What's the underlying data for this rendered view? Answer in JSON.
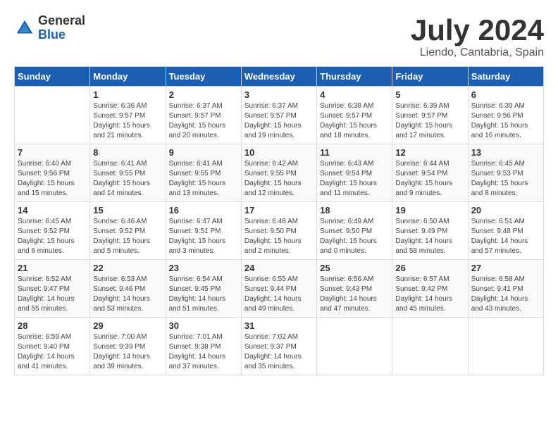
{
  "header": {
    "logo": {
      "general": "General",
      "blue": "Blue"
    },
    "month": "July 2024",
    "location": "Liendo, Cantabria, Spain"
  },
  "weekdays": [
    "Sunday",
    "Monday",
    "Tuesday",
    "Wednesday",
    "Thursday",
    "Friday",
    "Saturday"
  ],
  "weeks": [
    [
      {
        "day": "",
        "sunrise": "",
        "sunset": "",
        "daylight": ""
      },
      {
        "day": "1",
        "sunrise": "Sunrise: 6:36 AM",
        "sunset": "Sunset: 9:57 PM",
        "daylight": "Daylight: 15 hours and 21 minutes."
      },
      {
        "day": "2",
        "sunrise": "Sunrise: 6:37 AM",
        "sunset": "Sunset: 9:57 PM",
        "daylight": "Daylight: 15 hours and 20 minutes."
      },
      {
        "day": "3",
        "sunrise": "Sunrise: 6:37 AM",
        "sunset": "Sunset: 9:57 PM",
        "daylight": "Daylight: 15 hours and 19 minutes."
      },
      {
        "day": "4",
        "sunrise": "Sunrise: 6:38 AM",
        "sunset": "Sunset: 9:57 PM",
        "daylight": "Daylight: 15 hours and 18 minutes."
      },
      {
        "day": "5",
        "sunrise": "Sunrise: 6:39 AM",
        "sunset": "Sunset: 9:57 PM",
        "daylight": "Daylight: 15 hours and 17 minutes."
      },
      {
        "day": "6",
        "sunrise": "Sunrise: 6:39 AM",
        "sunset": "Sunset: 9:56 PM",
        "daylight": "Daylight: 15 hours and 16 minutes."
      }
    ],
    [
      {
        "day": "7",
        "sunrise": "Sunrise: 6:40 AM",
        "sunset": "Sunset: 9:56 PM",
        "daylight": "Daylight: 15 hours and 15 minutes."
      },
      {
        "day": "8",
        "sunrise": "Sunrise: 6:41 AM",
        "sunset": "Sunset: 9:55 PM",
        "daylight": "Daylight: 15 hours and 14 minutes."
      },
      {
        "day": "9",
        "sunrise": "Sunrise: 6:41 AM",
        "sunset": "Sunset: 9:55 PM",
        "daylight": "Daylight: 15 hours and 13 minutes."
      },
      {
        "day": "10",
        "sunrise": "Sunrise: 6:42 AM",
        "sunset": "Sunset: 9:55 PM",
        "daylight": "Daylight: 15 hours and 12 minutes."
      },
      {
        "day": "11",
        "sunrise": "Sunrise: 6:43 AM",
        "sunset": "Sunset: 9:54 PM",
        "daylight": "Daylight: 15 hours and 11 minutes."
      },
      {
        "day": "12",
        "sunrise": "Sunrise: 6:44 AM",
        "sunset": "Sunset: 9:54 PM",
        "daylight": "Daylight: 15 hours and 9 minutes."
      },
      {
        "day": "13",
        "sunrise": "Sunrise: 6:45 AM",
        "sunset": "Sunset: 9:53 PM",
        "daylight": "Daylight: 15 hours and 8 minutes."
      }
    ],
    [
      {
        "day": "14",
        "sunrise": "Sunrise: 6:45 AM",
        "sunset": "Sunset: 9:52 PM",
        "daylight": "Daylight: 15 hours and 6 minutes."
      },
      {
        "day": "15",
        "sunrise": "Sunrise: 6:46 AM",
        "sunset": "Sunset: 9:52 PM",
        "daylight": "Daylight: 15 hours and 5 minutes."
      },
      {
        "day": "16",
        "sunrise": "Sunrise: 6:47 AM",
        "sunset": "Sunset: 9:51 PM",
        "daylight": "Daylight: 15 hours and 3 minutes."
      },
      {
        "day": "17",
        "sunrise": "Sunrise: 6:48 AM",
        "sunset": "Sunset: 9:50 PM",
        "daylight": "Daylight: 15 hours and 2 minutes."
      },
      {
        "day": "18",
        "sunrise": "Sunrise: 6:49 AM",
        "sunset": "Sunset: 9:50 PM",
        "daylight": "Daylight: 15 hours and 0 minutes."
      },
      {
        "day": "19",
        "sunrise": "Sunrise: 6:50 AM",
        "sunset": "Sunset: 9:49 PM",
        "daylight": "Daylight: 14 hours and 58 minutes."
      },
      {
        "day": "20",
        "sunrise": "Sunrise: 6:51 AM",
        "sunset": "Sunset: 9:48 PM",
        "daylight": "Daylight: 14 hours and 57 minutes."
      }
    ],
    [
      {
        "day": "21",
        "sunrise": "Sunrise: 6:52 AM",
        "sunset": "Sunset: 9:47 PM",
        "daylight": "Daylight: 14 hours and 55 minutes."
      },
      {
        "day": "22",
        "sunrise": "Sunrise: 6:53 AM",
        "sunset": "Sunset: 9:46 PM",
        "daylight": "Daylight: 14 hours and 53 minutes."
      },
      {
        "day": "23",
        "sunrise": "Sunrise: 6:54 AM",
        "sunset": "Sunset: 9:45 PM",
        "daylight": "Daylight: 14 hours and 51 minutes."
      },
      {
        "day": "24",
        "sunrise": "Sunrise: 6:55 AM",
        "sunset": "Sunset: 9:44 PM",
        "daylight": "Daylight: 14 hours and 49 minutes."
      },
      {
        "day": "25",
        "sunrise": "Sunrise: 6:56 AM",
        "sunset": "Sunset: 9:43 PM",
        "daylight": "Daylight: 14 hours and 47 minutes."
      },
      {
        "day": "26",
        "sunrise": "Sunrise: 6:57 AM",
        "sunset": "Sunset: 9:42 PM",
        "daylight": "Daylight: 14 hours and 45 minutes."
      },
      {
        "day": "27",
        "sunrise": "Sunrise: 6:58 AM",
        "sunset": "Sunset: 9:41 PM",
        "daylight": "Daylight: 14 hours and 43 minutes."
      }
    ],
    [
      {
        "day": "28",
        "sunrise": "Sunrise: 6:59 AM",
        "sunset": "Sunset: 9:40 PM",
        "daylight": "Daylight: 14 hours and 41 minutes."
      },
      {
        "day": "29",
        "sunrise": "Sunrise: 7:00 AM",
        "sunset": "Sunset: 9:39 PM",
        "daylight": "Daylight: 14 hours and 39 minutes."
      },
      {
        "day": "30",
        "sunrise": "Sunrise: 7:01 AM",
        "sunset": "Sunset: 9:38 PM",
        "daylight": "Daylight: 14 hours and 37 minutes."
      },
      {
        "day": "31",
        "sunrise": "Sunrise: 7:02 AM",
        "sunset": "Sunset: 9:37 PM",
        "daylight": "Daylight: 14 hours and 35 minutes."
      },
      {
        "day": "",
        "sunrise": "",
        "sunset": "",
        "daylight": ""
      },
      {
        "day": "",
        "sunrise": "",
        "sunset": "",
        "daylight": ""
      },
      {
        "day": "",
        "sunrise": "",
        "sunset": "",
        "daylight": ""
      }
    ]
  ]
}
